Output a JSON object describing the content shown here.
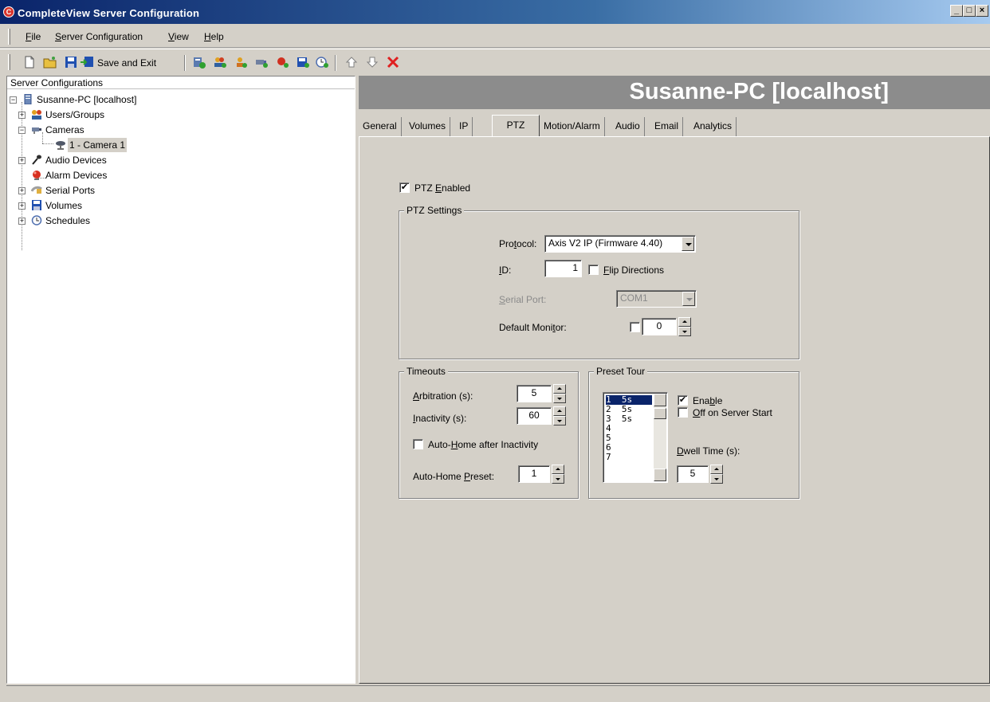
{
  "window": {
    "title": "CompleteView Server Configuration",
    "app_icon": "C"
  },
  "menu": [
    {
      "pre": "",
      "u": "F",
      "post": "ile"
    },
    {
      "pre": "",
      "u": "S",
      "post": "erver Configuration"
    },
    {
      "pre": "",
      "u": "V",
      "post": "iew"
    },
    {
      "pre": "",
      "u": "H",
      "post": "elp"
    }
  ],
  "toolbar": {
    "save_exit_label": "Save and Exit"
  },
  "tree": {
    "header": "Server Configurations",
    "root": "Susanne-PC [localhost]",
    "users_groups": "Users/Groups",
    "cameras": "Cameras",
    "camera1": "1 - Camera 1",
    "audio_devices": "Audio Devices",
    "alarm_devices": "Alarm Devices",
    "serial_ports": "Serial Ports",
    "volumes": "Volumes",
    "schedules": "Schedules"
  },
  "header_title": "Susanne-PC [localhost]",
  "tabs": [
    "General",
    "Volumes",
    "IP",
    "PTZ",
    "Motion/Alarm",
    "Audio",
    "Email",
    "Analytics"
  ],
  "active_tab": "PTZ",
  "ptz": {
    "enabled_pre": "PTZ ",
    "enabled_u": "E",
    "enabled_post": "nabled",
    "enabled_checked": "✔",
    "settings_title": "PTZ Settings",
    "protocol_pre": "Pro",
    "protocol_u": "t",
    "protocol_post": "ocol:",
    "protocol_value": "Axis V2 IP (Firmware 4.40)",
    "id_u": "I",
    "id_post": "D:",
    "id_value": "1",
    "flip_u": "F",
    "flip_post": "lip Directions",
    "serial_u": "S",
    "serial_post": "erial Port:",
    "serial_value": "COM1",
    "monitor_pre": "Default Moni",
    "monitor_u": "t",
    "monitor_post": "or:",
    "monitor_value": "0"
  },
  "timeouts": {
    "title": "Timeouts",
    "arb_u": "A",
    "arb_post": "rbitration (s):",
    "arb_value": "5",
    "inact_u": "I",
    "inact_post": "nactivity (s):",
    "inact_value": "60",
    "autohome_pre": "Auto-",
    "autohome_u": "H",
    "autohome_post": "ome after Inactivity",
    "preset_pre": "Auto-Home ",
    "preset_u": "P",
    "preset_post": "reset:",
    "preset_value": "1"
  },
  "preset_tour": {
    "title": "Preset Tour",
    "rows": [
      {
        "n": "1",
        "t": "5s"
      },
      {
        "n": "2",
        "t": "5s"
      },
      {
        "n": "3",
        "t": "5s"
      },
      {
        "n": "4",
        "t": ""
      },
      {
        "n": "5",
        "t": ""
      },
      {
        "n": "6",
        "t": ""
      },
      {
        "n": "7",
        "t": ""
      }
    ],
    "enable_pre": "Ena",
    "enable_u": "b",
    "enable_post": "le",
    "enable_checked": "✔",
    "off_u": "O",
    "off_post": "ff on Server Start",
    "dwell_u": "D",
    "dwell_post": "well Time (s):",
    "dwell_value": "5"
  }
}
